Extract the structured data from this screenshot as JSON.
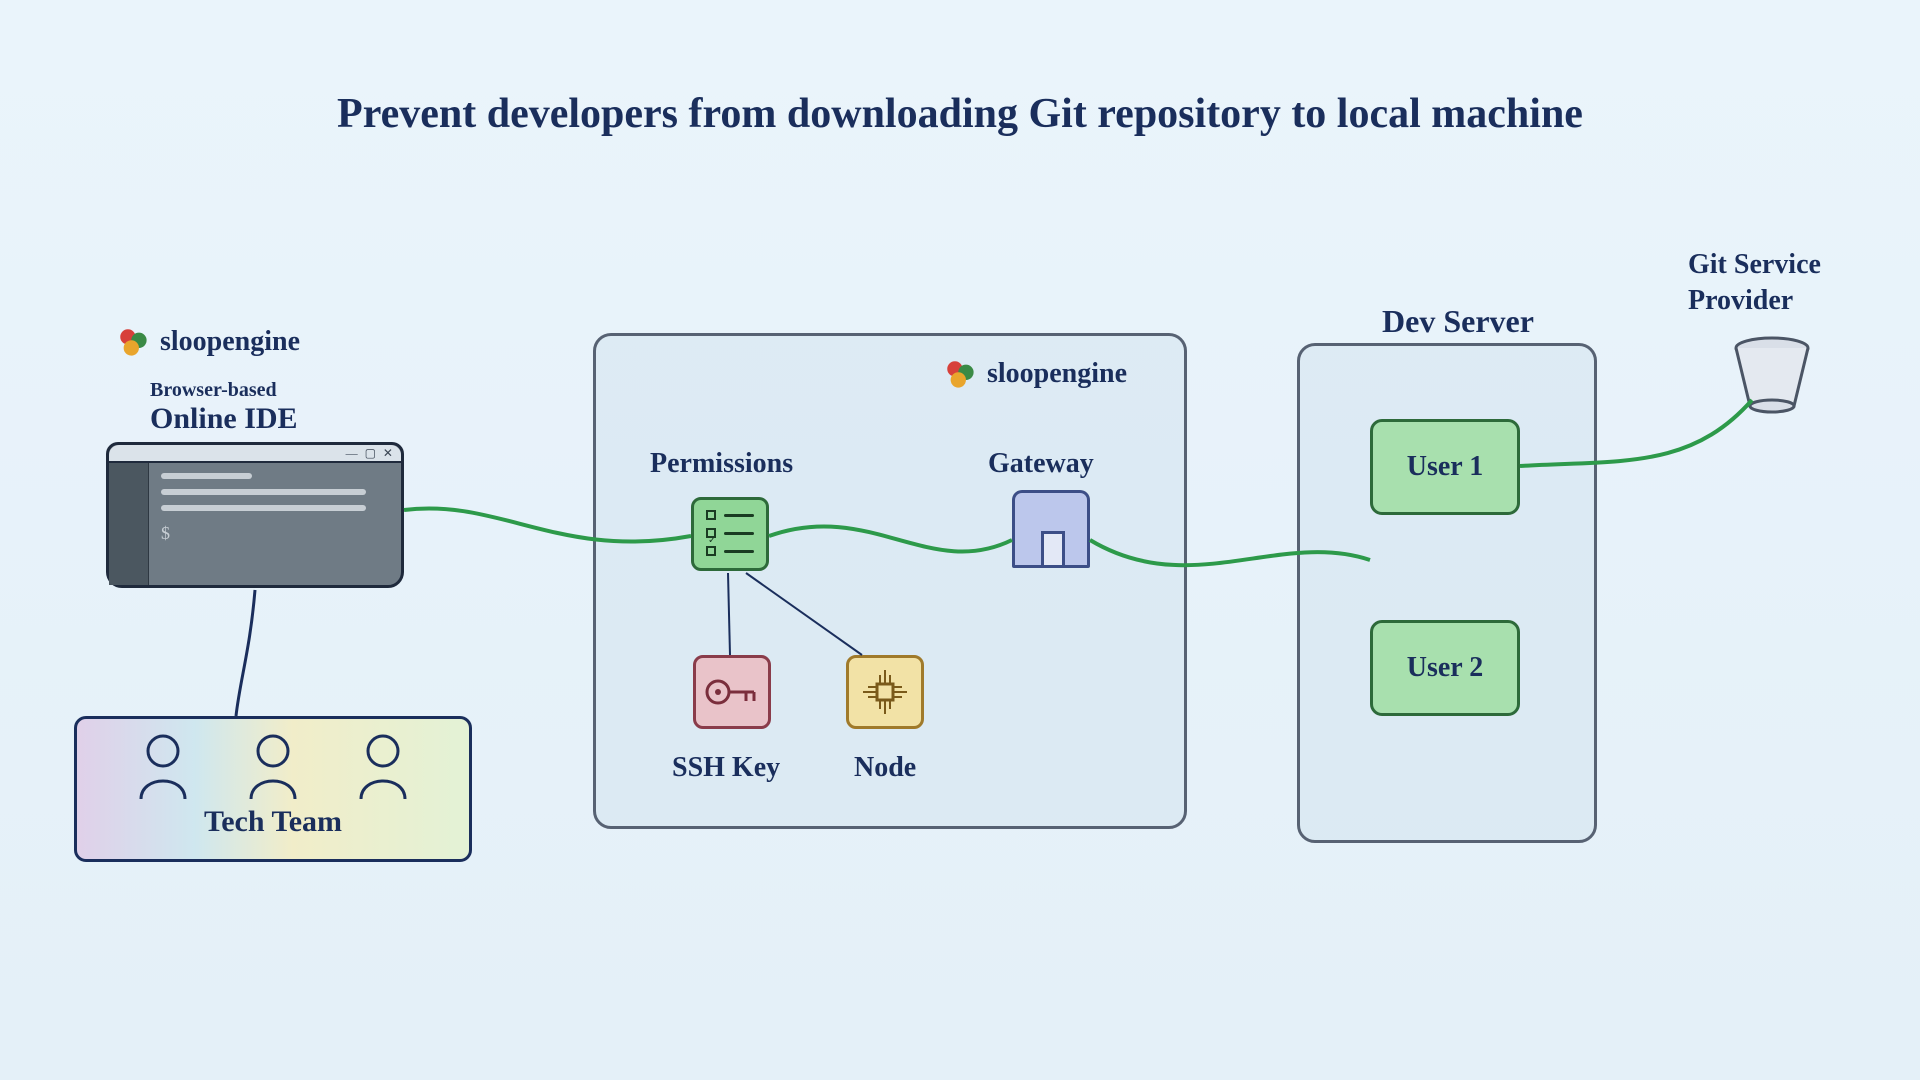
{
  "title": "Prevent developers from downloading Git repository to local machine",
  "brand_name": "sloopengine",
  "ide": {
    "sublabel_small": "Browser-based",
    "sublabel_big": "Online IDE"
  },
  "tech_team_label": "Tech Team",
  "sloop_box": {
    "permissions_label": "Permissions",
    "gateway_label": "Gateway",
    "sshkey_label": "SSH Key",
    "node_label": "Node"
  },
  "dev_server": {
    "label": "Dev Server",
    "user1": "User 1",
    "user2": "User 2"
  },
  "git_provider": {
    "line1": "Git Service",
    "line2": "Provider"
  },
  "colors": {
    "ink": "#1a2e5c",
    "green": "#2d9a4a",
    "wire": "#2d9a4a"
  }
}
